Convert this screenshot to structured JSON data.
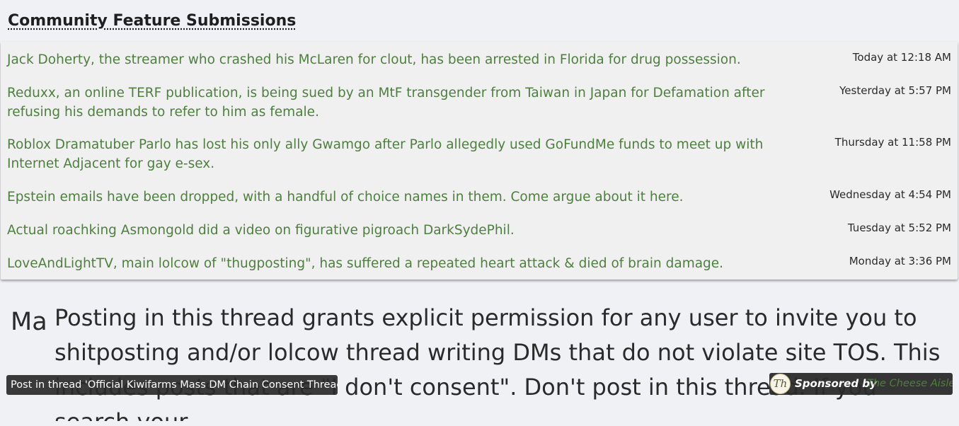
{
  "section": {
    "title": "Community Feature Submissions"
  },
  "features": [
    {
      "title": "Jack Doherty, the streamer who crashed his McLaren for clout, has been arrested in Florida for drug possession.",
      "time": "Today at 12:18 AM"
    },
    {
      "title": "Reduxx, an online TERF publication, is being sued by an MtF transgender from Taiwan in Japan for Defamation after refusing his demands to refer to him as female.",
      "time": "Yesterday at 5:57 PM"
    },
    {
      "title": "Roblox Dramatuber Parlo has lost his only ally Gwamgo after Parlo allegedly used GoFundMe funds to meet up with Internet Adjacent for gay e-sex.",
      "time": "Thursday at 11:58 PM"
    },
    {
      "title": "Epstein emails have been dropped, with a handful of choice names in them. Come argue about it here.",
      "time": "Wednesday at 4:54 PM"
    },
    {
      "title": "Actual roachking Asmongold did a video on figurative pigroach DarkSydePhil.",
      "time": "Tuesday at 5:52 PM"
    },
    {
      "title": "LoveAndLightTV, main lolcow of \"thugposting\", has suffered a repeated heart attack & died of brain damage.",
      "time": "Monday at 3:36 PM"
    }
  ],
  "notice": {
    "prefix": "Ma",
    "text": "Posting in this thread grants explicit permission for any user to invite you to shitposting and/or lolcow thread writing DMs that do not violate site TOS. This includes posts that are \"I don't consent\". Don't post in this thread. If you search your"
  },
  "tooltip": {
    "text": "Post in thread 'Official Kiwifarms Mass DM Chain Consent Thread'"
  },
  "sponsor": {
    "avatar_text": "Th",
    "label": "Sponsored by",
    "name": "The Cheese Aisle"
  },
  "colors": {
    "link": "#4d7f3e",
    "background": "#f0f1f5",
    "panel": "#f0f0f0",
    "tooltip": "#2a2a2a"
  }
}
